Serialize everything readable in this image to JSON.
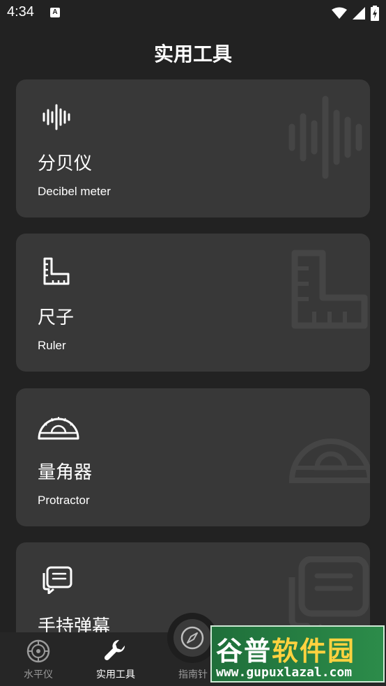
{
  "status_bar": {
    "time": "4:34",
    "app_icon_letter": "A",
    "icons": [
      "wifi-icon",
      "signal-icon",
      "battery-charging-icon"
    ]
  },
  "header": {
    "title": "实用工具"
  },
  "tools": [
    {
      "title": "分贝仪",
      "subtitle": "Decibel meter",
      "icon": "sound-wave-icon"
    },
    {
      "title": "尺子",
      "subtitle": "Ruler",
      "icon": "ruler-icon"
    },
    {
      "title": "量角器",
      "subtitle": "Protractor",
      "icon": "protractor-icon"
    },
    {
      "title": "手持弹幕",
      "subtitle": "",
      "icon": "message-icon"
    }
  ],
  "bottom_nav": {
    "items": [
      {
        "label": "水平仪",
        "icon": "level-icon",
        "active": false
      },
      {
        "label": "实用工具",
        "icon": "wrench-icon",
        "active": true
      },
      {
        "label": "指南针",
        "icon": "compass-icon",
        "active": false
      }
    ]
  },
  "watermark": {
    "logo_part1": "谷普",
    "logo_part2": "软件园",
    "url": "www.gupuxlazal.com"
  },
  "colors": {
    "background": "#222222",
    "card": "#383838",
    "nav": "#262626",
    "text": "#ffffff",
    "muted": "#9a9a9a"
  }
}
